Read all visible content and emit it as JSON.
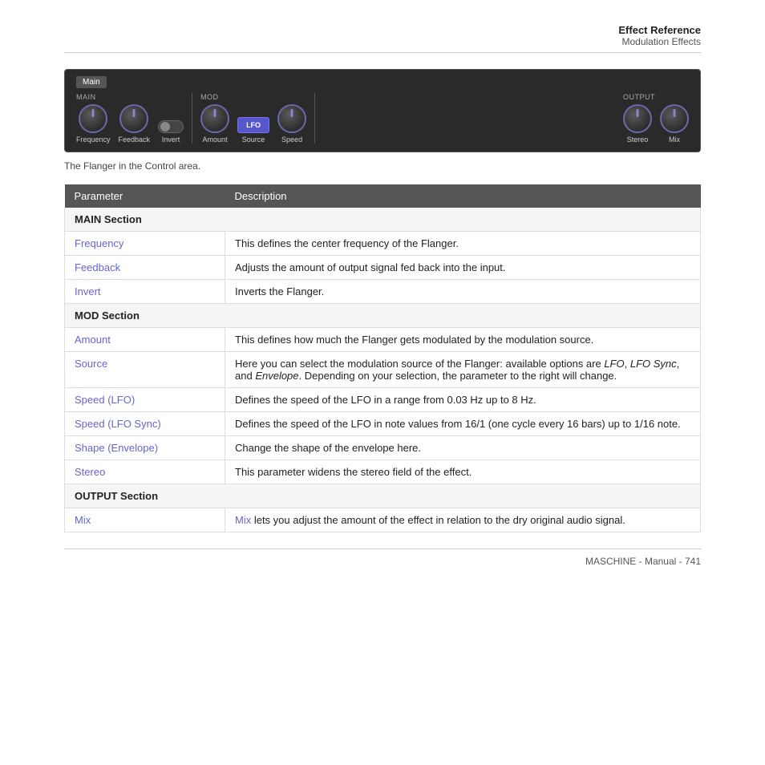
{
  "header": {
    "title": "Effect Reference",
    "subtitle": "Modulation Effects"
  },
  "control": {
    "tab": "Main",
    "sections": {
      "main": {
        "label": "MAIN",
        "knobs": [
          {
            "label": "Frequency"
          },
          {
            "label": "Feedback"
          },
          {
            "label": "Invert",
            "type": "toggle"
          }
        ]
      },
      "mod": {
        "label": "MOD",
        "knobs": [
          {
            "label": "Amount"
          },
          {
            "label": "Source",
            "type": "lfo"
          },
          {
            "label": "Speed"
          }
        ]
      },
      "output": {
        "label": "OUTPUT",
        "knobs": [
          {
            "label": "Stereo"
          },
          {
            "label": "Mix"
          }
        ]
      }
    }
  },
  "caption": "The Flanger in the Control area.",
  "table": {
    "headers": [
      "Parameter",
      "Description"
    ],
    "rows": [
      {
        "type": "section",
        "param": "MAIN Section",
        "desc": ""
      },
      {
        "type": "data",
        "param": "Frequency",
        "desc": "This defines the center frequency of the Flanger."
      },
      {
        "type": "data",
        "param": "Feedback",
        "desc": "Adjusts the amount of output signal fed back into the input."
      },
      {
        "type": "data",
        "param": "Invert",
        "desc": "Inverts the Flanger."
      },
      {
        "type": "section",
        "param": "MOD Section",
        "desc": ""
      },
      {
        "type": "data",
        "param": "Amount",
        "desc": "This defines how much the Flanger gets modulated by the modulation source."
      },
      {
        "type": "data",
        "param": "Source",
        "desc_parts": [
          {
            "text": "Here you can select the modulation source of the Flanger: available options are "
          },
          {
            "text": "LFO",
            "italic": true
          },
          {
            "text": ", "
          },
          {
            "text": "LFO Sync",
            "italic": true
          },
          {
            "text": ", and "
          },
          {
            "text": "Envelope",
            "italic": true
          },
          {
            "text": ". Depending on your selection, the parameter to the right will change."
          }
        ]
      },
      {
        "type": "data",
        "param": "Speed (LFO)",
        "param_parts": [
          {
            "text": "Speed",
            "blue": true
          },
          {
            "text": " (LFO)"
          }
        ],
        "desc": "Defines the speed of the LFO in a range from 0.03 Hz up to 8 Hz."
      },
      {
        "type": "data",
        "param": "Speed (LFO Sync)",
        "param_parts": [
          {
            "text": "Speed",
            "blue": true
          },
          {
            "text": " (LFO Sync)"
          }
        ],
        "desc": "Defines the speed of the LFO in note values from 16/1 (one cycle every 16 bars) up to 1/16 note."
      },
      {
        "type": "data",
        "param": "Shape (Envelope)",
        "param_parts": [
          {
            "text": "Shape",
            "blue": true
          },
          {
            "text": " (Envelope)"
          }
        ],
        "desc": "Change the shape of the envelope here."
      },
      {
        "type": "data",
        "param": "Stereo",
        "desc": "This parameter widens the stereo field of the effect."
      },
      {
        "type": "section",
        "param": "OUTPUT Section",
        "desc": ""
      },
      {
        "type": "data",
        "param": "Mix",
        "desc_parts": [
          {
            "text": "Mix",
            "blue": true
          },
          {
            "text": " lets you adjust the amount of the effect in relation to the dry original audio signal."
          }
        ]
      }
    ]
  },
  "footer": {
    "text": "MASCHINE - Manual - 741"
  }
}
